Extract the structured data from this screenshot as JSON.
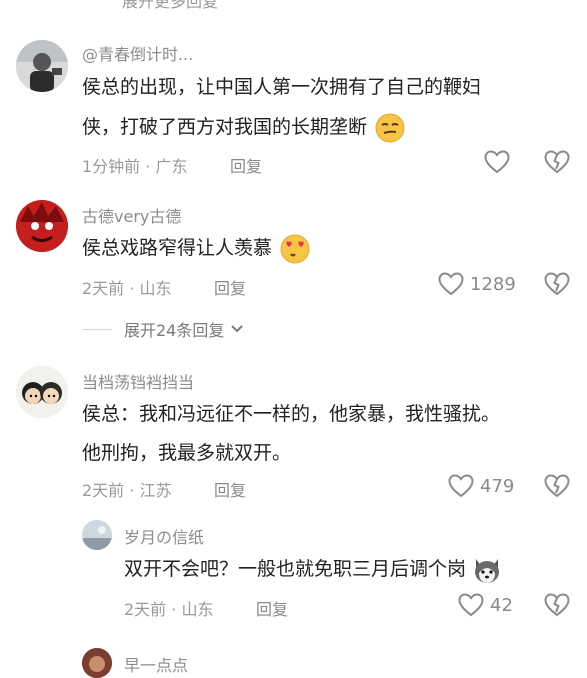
{
  "top_partial": "展开更多回复",
  "comments": [
    {
      "username": "@青春倒计时...",
      "lines": [
        "侯总的出现，让中国人第一次拥有了自己的鞭妇",
        "侠，打破了西方对我国的长期垄断"
      ],
      "time": "1分钟前",
      "location": "广东",
      "reply": "回复",
      "likes": ""
    },
    {
      "username": "古德very古德",
      "lines": [
        "侯总戏路窄得让人羡慕"
      ],
      "time": "2天前",
      "location": "山东",
      "reply": "回复",
      "likes": "1289"
    },
    {
      "username": "当档荡铛裆挡当",
      "lines": [
        "侯总：我和冯远征不一样的，他家暴，我性骚扰。",
        "他刑拘，我最多就双开。"
      ],
      "time": "2天前",
      "location": "江苏",
      "reply": "回复",
      "likes": "479"
    },
    {
      "username": "岁月の信纸",
      "lines": [
        "双开不会吧？一般也就免职三月后调个岗"
      ],
      "time": "2天前",
      "location": "山东",
      "reply": "回复",
      "likes": "42"
    },
    {
      "username": "早一点点"
    }
  ],
  "expand_replies": "展开24条回复",
  "separator": "·",
  "icons": {
    "like": "heart-outline-icon",
    "dislike": "broken-heart-icon",
    "expand": "chevron-down-icon"
  }
}
